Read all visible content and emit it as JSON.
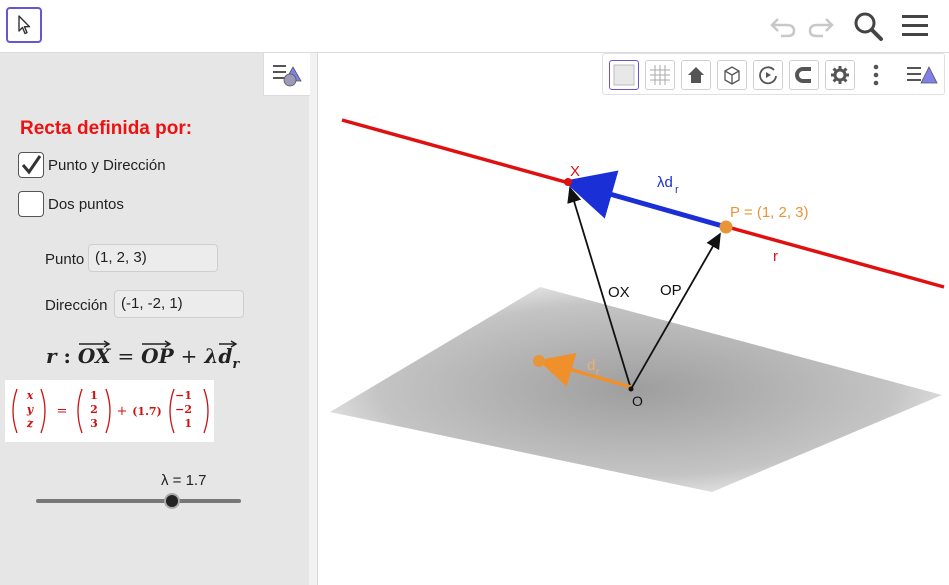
{
  "toolbar": {
    "icons": [
      "move-cursor-icon",
      "undo-icon",
      "redo-icon",
      "search-icon",
      "menu-icon"
    ]
  },
  "panel": {
    "heading": "Recta definida por:",
    "checkbox_point_direction": {
      "label": "Punto y Dirección",
      "checked": true
    },
    "checkbox_two_points": {
      "label": "Dos puntos",
      "checked": false
    },
    "point_label": "Punto",
    "point_value": "(1, 2, 3)",
    "direction_label": "Dirección",
    "direction_value": "(-1, -2, 1)",
    "equation": {
      "name": "r",
      "colon": ":",
      "lhs": "OX",
      "eq": "=",
      "op": "OP",
      "plus": "+",
      "lambda": "λ",
      "d": "d",
      "sub": "r"
    },
    "matrix": {
      "vars": [
        "x",
        "y",
        "z"
      ],
      "point": [
        "1",
        "2",
        "3"
      ],
      "coef": "(1.7)",
      "direction": [
        "−1",
        "−2",
        "1"
      ]
    },
    "slider": {
      "label": "λ = 1.7",
      "value": 1.7,
      "min": -5,
      "max": 5
    }
  },
  "graphics_toolbar": {
    "icons": [
      "background-icon",
      "grid-icon",
      "home-icon",
      "cube-view-icon",
      "rotate-icon",
      "magnet-icon",
      "gear-icon",
      "more-vertical-icon",
      "style-bar-icon"
    ]
  },
  "scene": {
    "line_label": "r",
    "point_x_label": "X",
    "point_p_label": "P = (1, 2, 3)",
    "origin_label": "O",
    "vector_ox_label": "OX",
    "vector_op_label": "OP",
    "lambda_d_label": "λd",
    "lambda_d_sub": "r",
    "direction_label": "d",
    "direction_sub": "r",
    "colors": {
      "line": "#e01010",
      "lambda_vector": "#1a2fd6",
      "direction_vector": "#f0902a",
      "point_p": "#e8953a",
      "point_x": "#e01010",
      "plane": "#bdbdbd",
      "equation_matrix": "#cc1111"
    }
  }
}
